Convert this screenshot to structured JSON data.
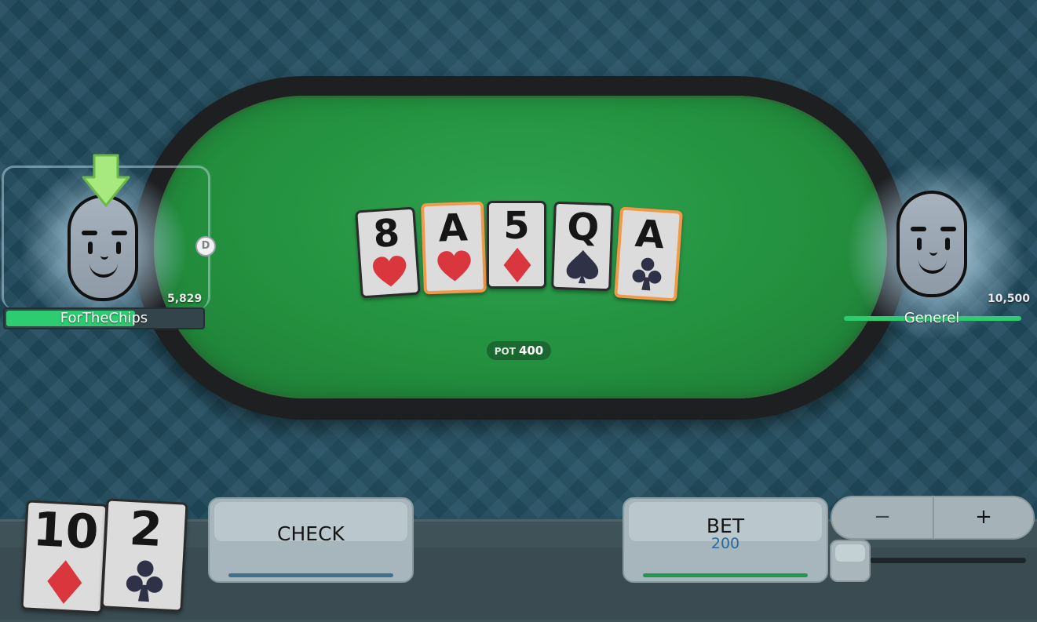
{
  "pot": {
    "label": "POT",
    "amount": "400"
  },
  "players": [
    {
      "name": "ForTheChips",
      "stack": "5,829",
      "dealer": "D",
      "bar_fill": 0.65,
      "bar_color": "#2ecc71"
    },
    {
      "name": "Generel",
      "stack": "10,500",
      "bar_fill": 1.0,
      "bar_color": "#2ecc71"
    }
  ],
  "board": [
    {
      "rank": "8",
      "suit": "hearts",
      "highlight": false
    },
    {
      "rank": "A",
      "suit": "hearts",
      "highlight": true
    },
    {
      "rank": "5",
      "suit": "diamonds",
      "highlight": false
    },
    {
      "rank": "Q",
      "suit": "spades",
      "highlight": false
    },
    {
      "rank": "A",
      "suit": "clubs",
      "highlight": true
    }
  ],
  "hole_cards": [
    {
      "rank": "10",
      "suit": "diamonds"
    },
    {
      "rank": "2",
      "suit": "clubs"
    }
  ],
  "actions": {
    "check_label": "CHECK",
    "bet_label": "BET",
    "bet_amount": "200",
    "minus_label": "−",
    "plus_label": "+"
  },
  "colors": {
    "felt": "#23913f",
    "highlight": "#f2994a",
    "red_suit": "#d9363e",
    "black_suit": "#2f3147"
  },
  "icons": [
    "turn-arrow-icon",
    "dealer-button-icon",
    "heart-icon",
    "diamond-icon",
    "spade-icon",
    "club-icon"
  ]
}
